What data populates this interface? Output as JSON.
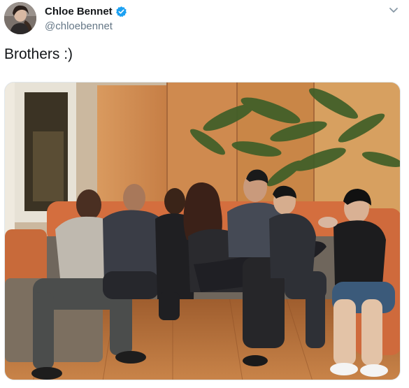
{
  "tweet": {
    "display_name": "Chloe Bennet",
    "handle": "@chloebennet",
    "text": "Brothers :)",
    "verified": true,
    "avatar_icon": "profile-avatar",
    "menu_icon": "chevron-down-icon",
    "colors": {
      "name": "#14171a",
      "handle": "#657786",
      "verified": "#1da1f2"
    }
  }
}
